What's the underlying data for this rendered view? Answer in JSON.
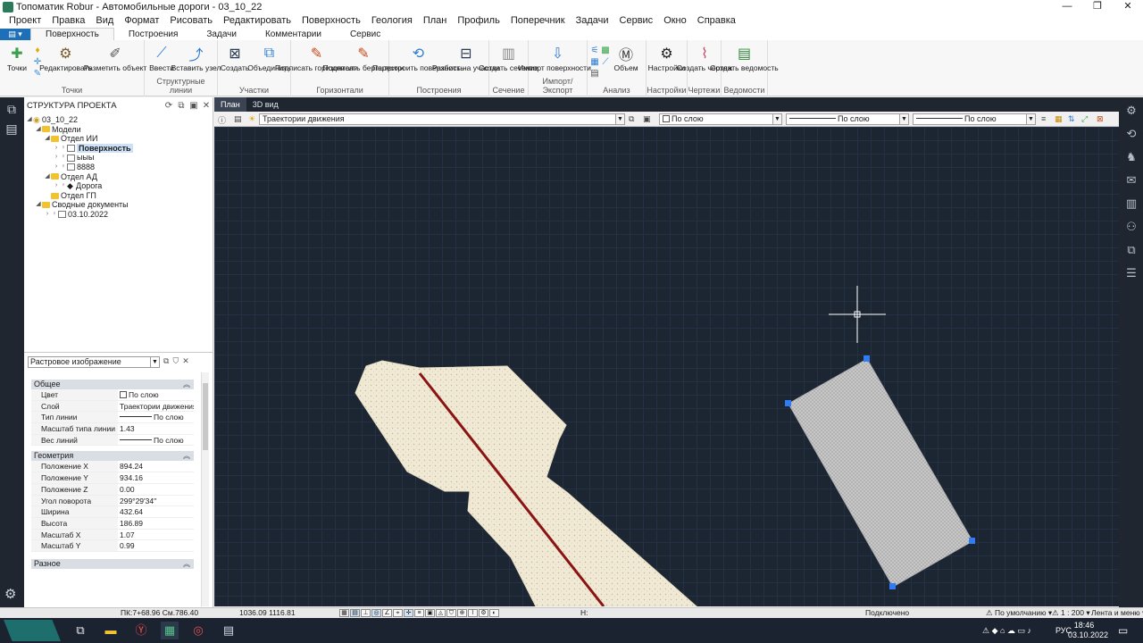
{
  "window": {
    "title": "Топоматик Robur - Автомобильные дороги - 03_10_22",
    "controls": [
      "—",
      "❐",
      "✕"
    ]
  },
  "menu": [
    "Проект",
    "Правка",
    "Вид",
    "Формат",
    "Рисовать",
    "Редактировать",
    "Поверхность",
    "Геология",
    "План",
    "Профиль",
    "Поперечник",
    "Задачи",
    "Сервис",
    "Окно",
    "Справка"
  ],
  "ribbon_tabs": [
    "Поверхность",
    "Построения",
    "Задачи",
    "Комментарии",
    "Сервис"
  ],
  "ribbon": {
    "groups": [
      {
        "name": "Точки",
        "buttons": [
          "Точки",
          "Редактировать",
          "Разметить объект"
        ]
      },
      {
        "name": "Структурные линии",
        "buttons": [
          "Ввести",
          "Вставить узел"
        ]
      },
      {
        "name": "Участки",
        "buttons": [
          "Создать",
          "Объединить"
        ]
      },
      {
        "name": "Горизонтали",
        "buttons": [
          "Подписать горизонтали",
          "Подписать бергштрихи"
        ]
      },
      {
        "name": "Построения",
        "buttons": [
          "Перестроить поверхность",
          "Разбить на участки"
        ]
      },
      {
        "name": "Сечение",
        "buttons": [
          "Создать сечение"
        ]
      },
      {
        "name": "Импорт/Экспорт",
        "buttons": [
          "Импорт поверхности..."
        ]
      },
      {
        "name": "Анализ",
        "buttons": [
          "Объем"
        ]
      },
      {
        "name": "Настройки",
        "buttons": [
          "Настройки"
        ]
      },
      {
        "name": "Чертежи",
        "buttons": [
          "Создать чертеж"
        ]
      },
      {
        "name": "Ведомости",
        "buttons": [
          "Создать ведомость"
        ]
      }
    ]
  },
  "project_tree": {
    "title": "СТРУКТУРА ПРОЕКТА",
    "items": [
      {
        "label": "03_10_22",
        "level": 0
      },
      {
        "label": "Модели",
        "level": 1
      },
      {
        "label": "Отдел ИИ",
        "level": 2
      },
      {
        "label": "Поверхность",
        "level": 3,
        "selected": true
      },
      {
        "label": "ыыы",
        "level": 3
      },
      {
        "label": "8888",
        "level": 3
      },
      {
        "label": "Отдел АД",
        "level": 2
      },
      {
        "label": "Дорога",
        "level": 3
      },
      {
        "label": "Отдел ГП",
        "level": 2
      },
      {
        "label": "Сводные документы",
        "level": 1
      },
      {
        "label": "03.10.2022",
        "level": 2
      }
    ]
  },
  "properties": {
    "object_type": "Растровое изображение",
    "categories": [
      {
        "name": "Общее",
        "rows": [
          {
            "key": "Цвет",
            "value": "По слою",
            "kind": "check"
          },
          {
            "key": "Слой",
            "value": "Траектории движения"
          },
          {
            "key": "Тип линии",
            "value": "По слою",
            "kind": "line"
          },
          {
            "key": "Масштаб типа линии",
            "value": "1.43"
          },
          {
            "key": "Вес линий",
            "value": "По слою",
            "kind": "line"
          }
        ]
      },
      {
        "name": "Геометрия",
        "rows": [
          {
            "key": "Положение X",
            "value": "894.24"
          },
          {
            "key": "Положение Y",
            "value": "934.16"
          },
          {
            "key": "Положение Z",
            "value": "0.00"
          },
          {
            "key": "Угол поворота",
            "value": "299°29'34\""
          },
          {
            "key": "Ширина",
            "value": "432.64"
          },
          {
            "key": "Высота",
            "value": "186.89"
          },
          {
            "key": "Масштаб X",
            "value": "1.07"
          },
          {
            "key": "Масштаб Y",
            "value": "0.99"
          }
        ]
      },
      {
        "name": "Разное",
        "rows": []
      }
    ]
  },
  "view_tabs": [
    "План",
    "3D вид"
  ],
  "layer_toolbar": {
    "layer": "Траектории движения",
    "color": "По слою",
    "linetype": "По слою",
    "lineweight": "По слою"
  },
  "status_bar": {
    "station": "ПК:7+68.96 См.786.40",
    "coords": "1036.09 1116.81",
    "h_label": "Н:",
    "connection": "Подключено",
    "style": "По умолчанию",
    "scale": "1 : 200",
    "ribbon_mode": "Лента и меню"
  },
  "taskbar": {
    "lang": "РУС",
    "time": "18:46",
    "date": "03.10.2022"
  }
}
